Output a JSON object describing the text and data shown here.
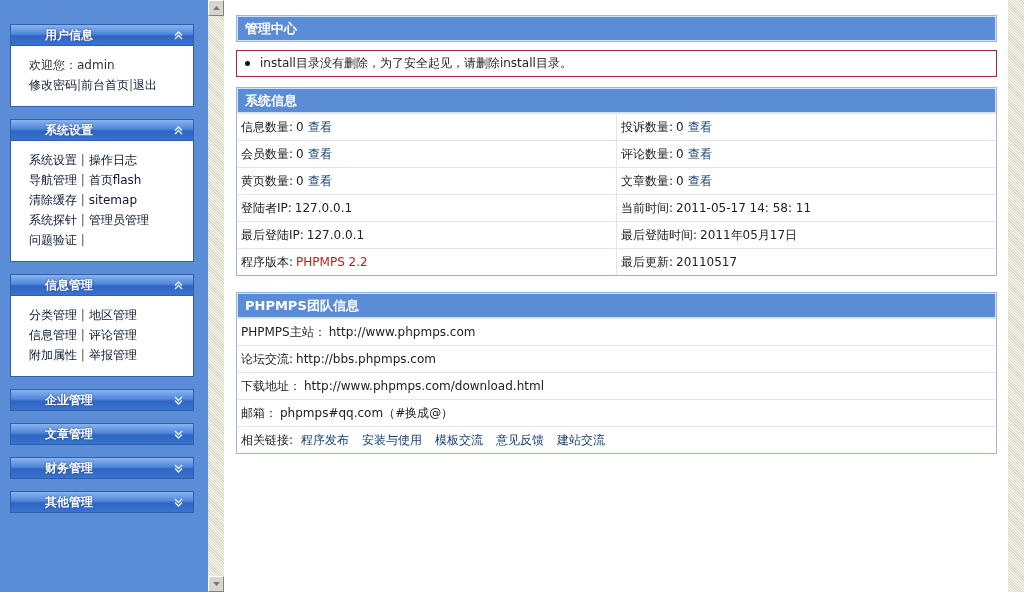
{
  "sidebar": {
    "panels": [
      {
        "title": "用户信息",
        "expanded": true,
        "rows": [
          [
            {
              "kind": "text",
              "text": "欢迎您：admin"
            }
          ],
          [
            {
              "kind": "link",
              "text": "修改密码"
            },
            {
              "kind": "sep",
              "text": "|"
            },
            {
              "kind": "link",
              "text": "前台首页"
            },
            {
              "kind": "sep",
              "text": "|"
            },
            {
              "kind": "link",
              "text": "退出"
            }
          ]
        ]
      },
      {
        "title": "系统设置",
        "expanded": true,
        "rows": [
          [
            {
              "kind": "link",
              "text": "系统设置"
            },
            {
              "kind": "sep",
              "text": " | "
            },
            {
              "kind": "link",
              "text": "操作日志"
            }
          ],
          [
            {
              "kind": "link",
              "text": "导航管理"
            },
            {
              "kind": "sep",
              "text": " | "
            },
            {
              "kind": "link",
              "text": "首页flash"
            }
          ],
          [
            {
              "kind": "link",
              "text": "清除缓存"
            },
            {
              "kind": "sep",
              "text": " | "
            },
            {
              "kind": "link",
              "text": "sitemap"
            }
          ],
          [
            {
              "kind": "link",
              "text": "系统探针"
            },
            {
              "kind": "sep",
              "text": " | "
            },
            {
              "kind": "link",
              "text": "管理员管理"
            }
          ],
          [
            {
              "kind": "link",
              "text": "问题验证"
            },
            {
              "kind": "sep",
              "text": " |"
            }
          ]
        ]
      },
      {
        "title": "信息管理",
        "expanded": true,
        "rows": [
          [
            {
              "kind": "link",
              "text": "分类管理"
            },
            {
              "kind": "sep",
              "text": " | "
            },
            {
              "kind": "link",
              "text": "地区管理"
            }
          ],
          [
            {
              "kind": "link",
              "text": "信息管理"
            },
            {
              "kind": "sep",
              "text": " | "
            },
            {
              "kind": "link",
              "text": "评论管理"
            }
          ],
          [
            {
              "kind": "link",
              "text": "附加属性"
            },
            {
              "kind": "sep",
              "text": " | "
            },
            {
              "kind": "link",
              "text": "举报管理"
            }
          ]
        ]
      },
      {
        "title": "企业管理",
        "expanded": false
      },
      {
        "title": "文章管理",
        "expanded": false
      },
      {
        "title": "财务管理",
        "expanded": false
      },
      {
        "title": "其他管理",
        "expanded": false
      }
    ]
  },
  "main": {
    "title": "管理中心",
    "notices": [
      "install目录没有删除，为了安全起见，请删除install目录。"
    ],
    "system_info": {
      "title": "系统信息",
      "rows": [
        [
          {
            "kind": "count",
            "label": "信息数量:",
            "value": "0",
            "link": "查看"
          },
          {
            "kind": "count",
            "label": "投诉数量:",
            "value": "0",
            "link": "查看"
          }
        ],
        [
          {
            "kind": "count",
            "label": "会员数量:",
            "value": "0",
            "link": "查看"
          },
          {
            "kind": "count",
            "label": "评论数量:",
            "value": "0",
            "link": "查看"
          }
        ],
        [
          {
            "kind": "count",
            "label": "黄页数量:",
            "value": "0",
            "link": "查看"
          },
          {
            "kind": "count",
            "label": "文章数量:",
            "value": "0",
            "link": "查看"
          }
        ],
        [
          {
            "kind": "plain",
            "label": "登陆者IP:",
            "value": "127.0.0.1"
          },
          {
            "kind": "plain",
            "label": "当前时间:",
            "value": "2011-05-17 14: 58: 11"
          }
        ],
        [
          {
            "kind": "plain",
            "label": "最后登陆IP:",
            "value": "127.0.0.1"
          },
          {
            "kind": "plain",
            "label": "最后登陆时间:",
            "value": "2011年05月17日"
          }
        ],
        [
          {
            "kind": "highlight",
            "label": "程序版本:",
            "value": "PHPMPS 2.2"
          },
          {
            "kind": "plain",
            "label": "最后更新:",
            "value": "20110517"
          }
        ]
      ]
    },
    "team": {
      "title": "PHPMPS团队信息",
      "rows": [
        {
          "kind": "plain",
          "label": "PHPMPS主站：",
          "value": "http://www.phpmps.com"
        },
        {
          "kind": "plain",
          "label": "论坛交流:",
          "value": "http://bbs.phpmps.com"
        },
        {
          "kind": "plain",
          "label": "下载地址：",
          "value": "http://www.phpmps.com/download.html"
        },
        {
          "kind": "plain",
          "label": "邮箱：",
          "value": "phpmps#qq.com（#换成@）"
        },
        {
          "kind": "links",
          "label": "相关链接:",
          "links": [
            "程序发布",
            "安装与使用",
            "模板交流",
            "意见反馈",
            "建站交流"
          ]
        }
      ]
    }
  }
}
